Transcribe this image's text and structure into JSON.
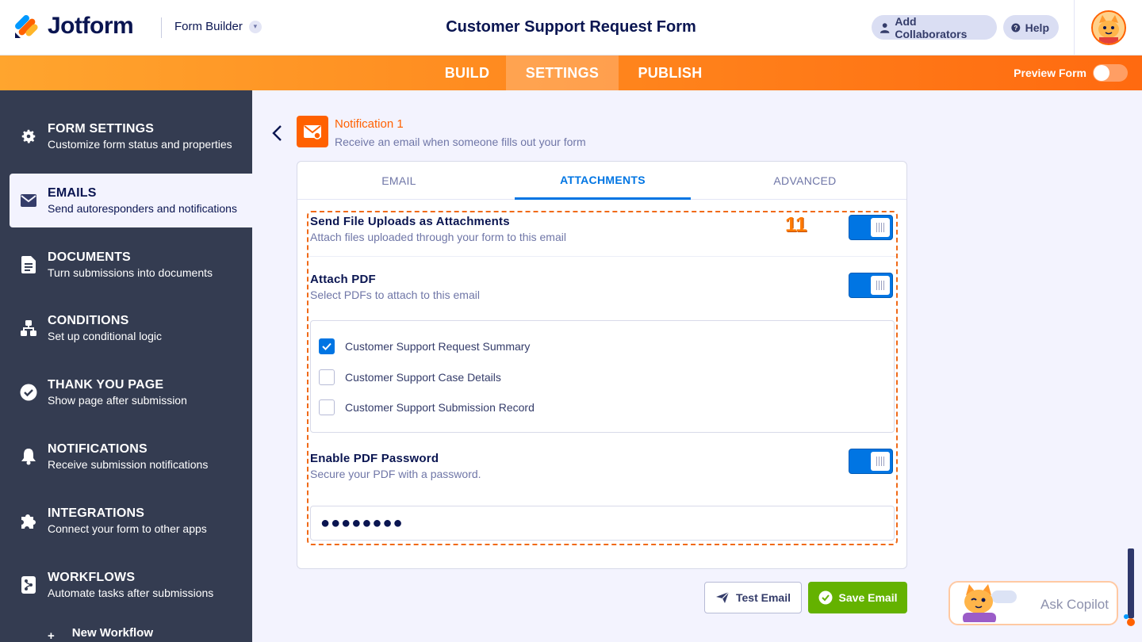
{
  "header": {
    "logo_text": "Jotform",
    "builder_label": "Form Builder",
    "form_title": "Customer Support Request Form",
    "add_collaborators": "Add Collaborators",
    "help": "Help"
  },
  "nav": {
    "tabs": [
      "BUILD",
      "SETTINGS",
      "PUBLISH"
    ],
    "active_tab": "SETTINGS",
    "preview_label": "Preview Form",
    "preview_on": false
  },
  "sidebar": {
    "items": [
      {
        "title": "FORM SETTINGS",
        "sub": "Customize form status and properties",
        "icon": "gear-icon"
      },
      {
        "title": "EMAILS",
        "sub": "Send autoresponders and notifications",
        "icon": "envelope-icon"
      },
      {
        "title": "DOCUMENTS",
        "sub": "Turn submissions into documents",
        "icon": "document-icon"
      },
      {
        "title": "CONDITIONS",
        "sub": "Set up conditional logic",
        "icon": "hierarchy-icon"
      },
      {
        "title": "THANK YOU PAGE",
        "sub": "Show page after submission",
        "icon": "check-circle-icon"
      },
      {
        "title": "NOTIFICATIONS",
        "sub": "Receive submission notifications",
        "icon": "bell-icon"
      },
      {
        "title": "INTEGRATIONS",
        "sub": "Connect your form to other apps",
        "icon": "puzzle-icon"
      },
      {
        "title": "WORKFLOWS",
        "sub": "Automate tasks after submissions",
        "icon": "workflow-icon"
      }
    ],
    "active_index": 1,
    "new_workflow": "New Workflow"
  },
  "notification": {
    "title": "Notification 1",
    "subtitle": "Receive an email when someone fills out your form"
  },
  "tabs": {
    "email": "EMAIL",
    "attachments": "ATTACHMENTS",
    "advanced": "ADVANCED",
    "active": "ATTACHMENTS"
  },
  "settings": {
    "file_uploads": {
      "title": "Send File Uploads as Attachments",
      "sub": "Attach files uploaded through your form to this email",
      "on": true
    },
    "attach_pdf": {
      "title": "Attach PDF",
      "sub": "Select PDFs to attach to this email",
      "on": true
    },
    "pdfs": [
      {
        "label": "Customer Support Request Summary",
        "checked": true
      },
      {
        "label": "Customer Support Case Details",
        "checked": false
      },
      {
        "label": "Customer Support Submission Record",
        "checked": false
      }
    ],
    "pdf_password": {
      "title": "Enable PDF Password",
      "sub": "Secure your PDF with a password.",
      "on": true
    },
    "password_value": "●●●●●●●●"
  },
  "step_badge": "11",
  "buttons": {
    "test_email": "Test Email",
    "save_email": "Save Email"
  },
  "copilot": {
    "label": "Ask Copilot"
  },
  "colors": {
    "brand_orange": "#ff6100",
    "accent_blue": "#0075e3",
    "save_green": "#64b200",
    "sidebar_bg": "#343c51"
  }
}
